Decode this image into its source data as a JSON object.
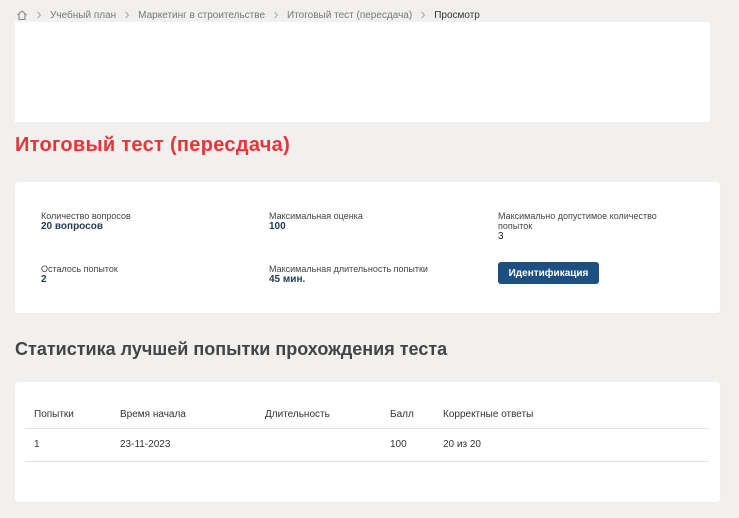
{
  "breadcrumb": {
    "items": [
      "Учебный план",
      "Маркетинг в строительстве",
      "Итоговый тест (пересдача)"
    ],
    "current": "Просмотр"
  },
  "page": {
    "title": "Итоговый тест (пересдача)"
  },
  "info": {
    "questions_label": "Количество вопросов",
    "questions_value": "20 вопросов",
    "max_score_label": "Максимальная оценка",
    "max_score_value": "100",
    "max_attempts_label": "Максимально допустимое количество попыток",
    "max_attempts_value": "3",
    "remaining_label": "Осталось попыток",
    "remaining_value": "2",
    "duration_label": "Максимальная длительность попытки",
    "duration_value": "45 мин.",
    "ident_button": "Идентификация"
  },
  "stats": {
    "title": "Статистика лучшей попытки прохождения теста",
    "columns": [
      "Попытки",
      "Время начала",
      "Длительность",
      "Балл",
      "Корректные ответы"
    ],
    "rows": [
      [
        "1",
        "23-11-2023",
        "",
        "100",
        "20 из 20"
      ]
    ]
  },
  "colors": {
    "title_red": "#e8343a",
    "button_blue": "#1c4f82",
    "value_blue": "#1f3a5f"
  }
}
